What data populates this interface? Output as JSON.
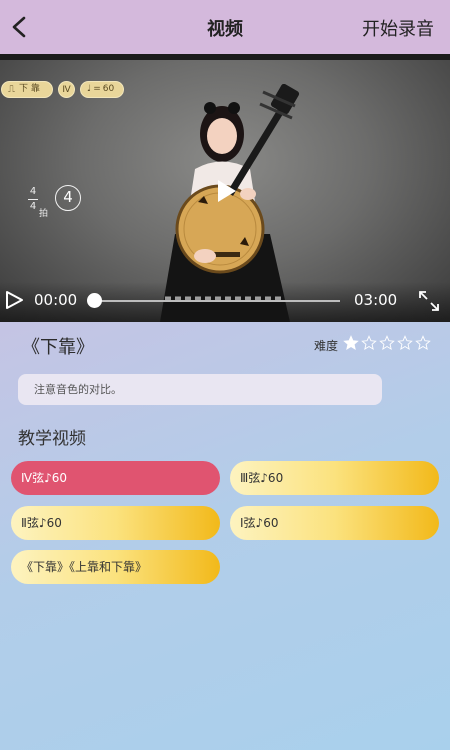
{
  "header": {
    "title": "视频",
    "action_label": "开始录音"
  },
  "video": {
    "mode_chip": "下 靠",
    "circle_chip": "Ⅳ",
    "tempo_value": "60",
    "time_signature_top": "4",
    "time_signature_bottom": "4",
    "beat_unit": "拍",
    "beat_count": "4",
    "current_time": "00:00",
    "total_time": "03:00",
    "progress": 0
  },
  "piece": {
    "title": "《下靠》",
    "difficulty_label": "难度",
    "difficulty": 1,
    "difficulty_max": 5,
    "note": "注意音色的对比。"
  },
  "teaching": {
    "section_title": "教学视频",
    "items": [
      {
        "label": "Ⅳ弦♪60",
        "active": true
      },
      {
        "label": "Ⅲ弦♪60",
        "active": false
      },
      {
        "label": "Ⅱ弦♪60",
        "active": false
      },
      {
        "label": "Ⅰ弦♪60",
        "active": false
      },
      {
        "label": "《下靠》《上靠和下靠》",
        "active": false
      }
    ]
  },
  "colors": {
    "header_bg": "#d4b9dc",
    "active_pill": "#e05470",
    "pill_gradient_end": "#f2b91a",
    "star_filled": "#ffffff"
  }
}
